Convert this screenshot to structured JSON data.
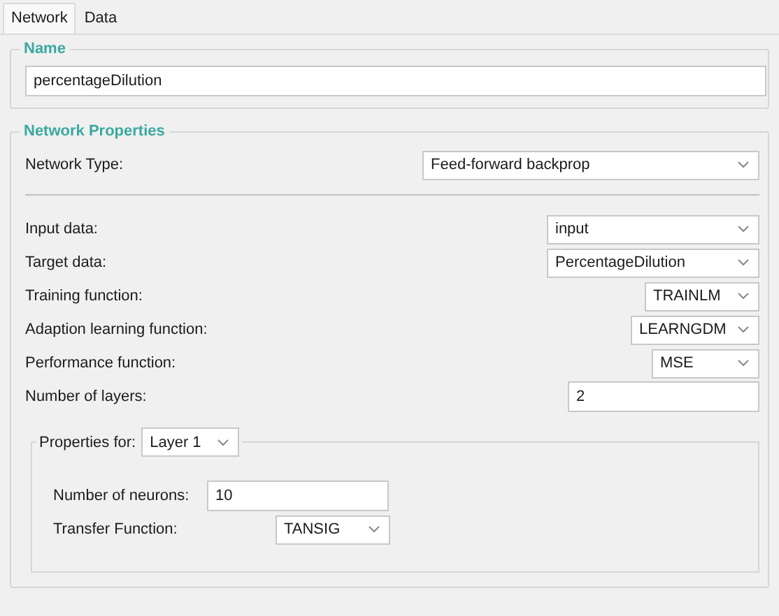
{
  "tabs": [
    {
      "label": "Network",
      "selected": true
    },
    {
      "label": "Data",
      "selected": false
    }
  ],
  "name_group": {
    "title": "Name",
    "value": "percentageDilution"
  },
  "network_properties": {
    "title": "Network Properties",
    "network_type": {
      "label": "Network Type:",
      "value": "Feed-forward backprop"
    },
    "fields": [
      {
        "kind": "combo",
        "label": "Input data:",
        "value": "input"
      },
      {
        "kind": "combo",
        "label": "Target data:",
        "value": "PercentageDilution"
      },
      {
        "kind": "combo",
        "label": "Training function:",
        "value": "TRAINLM"
      },
      {
        "kind": "combo",
        "label": "Adaption learning function:",
        "value": "LEARNGDM"
      },
      {
        "kind": "combo",
        "label": "Performance function:",
        "value": "MSE"
      },
      {
        "kind": "text",
        "label": "Number of layers:",
        "value": "2"
      }
    ],
    "layer_properties": {
      "label": "Properties for:",
      "layer": "Layer 1",
      "fields": [
        {
          "kind": "text",
          "label": "Number of neurons:",
          "value": "10"
        },
        {
          "kind": "combo",
          "label": "Transfer Function:",
          "value": "TANSIG"
        }
      ]
    }
  }
}
